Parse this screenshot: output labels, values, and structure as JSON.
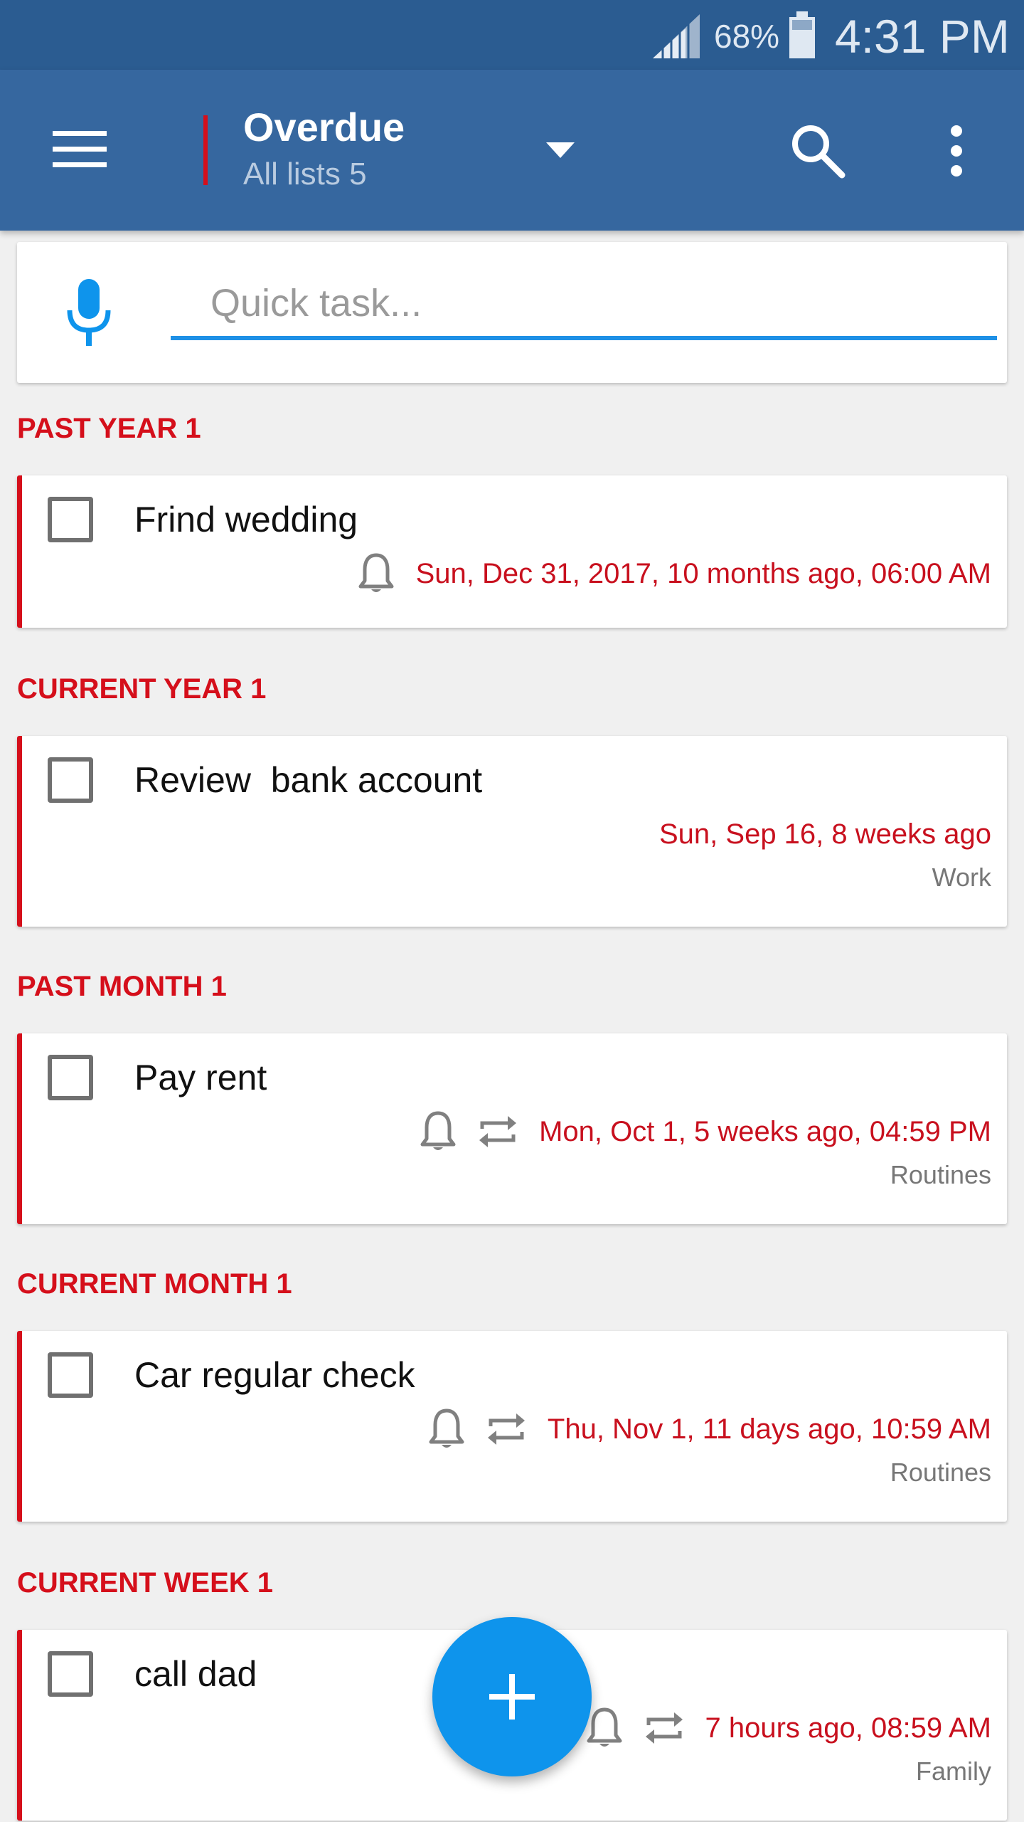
{
  "status_bar": {
    "battery_percent": "68%",
    "time": "4:31 PM"
  },
  "app_bar": {
    "title": "Overdue",
    "subtitle": "All lists 5",
    "icons": {
      "menu": "menu-icon",
      "dropdown": "dropdown-arrow-icon",
      "search": "search-icon",
      "more": "more-vert-icon"
    }
  },
  "quick_task": {
    "placeholder": "Quick task...",
    "value": ""
  },
  "colors": {
    "status_bar": "#2b5c91",
    "app_bar": "#36679f",
    "overdue_red": "#d50f1b",
    "accent_blue": "#0e94ec",
    "background": "#f0f0f0"
  },
  "sections": [
    {
      "header": "PAST YEAR 1",
      "task": {
        "title": "Frind wedding",
        "date": "Sun, Dec 31, 2017, 10 months ago, 06:00 AM",
        "list": "",
        "reminder": true,
        "repeat": false
      }
    },
    {
      "header": "CURRENT YEAR 1",
      "task": {
        "title": "Review  bank account",
        "date": "Sun, Sep 16, 8 weeks ago",
        "list": "Work",
        "reminder": false,
        "repeat": false
      }
    },
    {
      "header": "PAST MONTH 1",
      "task": {
        "title": "Pay rent",
        "date": "Mon, Oct 1, 5 weeks ago, 04:59 PM",
        "list": "Routines",
        "reminder": true,
        "repeat": true
      }
    },
    {
      "header": "CURRENT MONTH 1",
      "task": {
        "title": "Car regular check",
        "date": "Thu, Nov 1, 11 days ago, 10:59 AM",
        "list": "Routines",
        "reminder": true,
        "repeat": true
      }
    },
    {
      "header": "CURRENT WEEK 1",
      "task": {
        "title": "call dad",
        "date": "7 hours ago, 08:59 AM",
        "list": "Family",
        "reminder": true,
        "repeat": true
      }
    }
  ],
  "fab": {
    "icon": "plus-icon"
  }
}
